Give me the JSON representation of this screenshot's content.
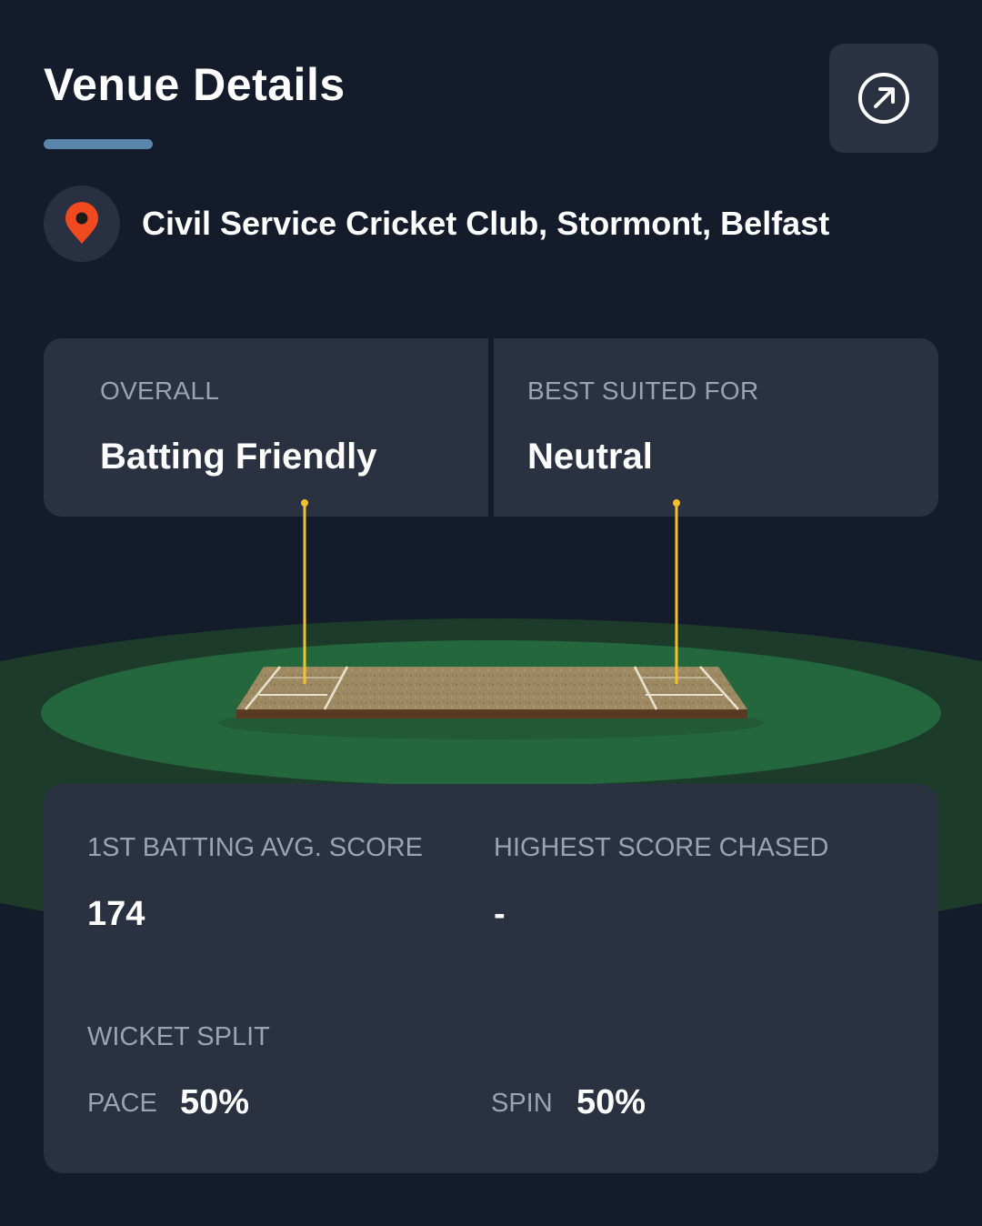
{
  "header": {
    "title": "Venue Details",
    "open_icon": "arrow-up-right-circle-icon"
  },
  "venue": {
    "icon": "location-pin-icon",
    "name": "Civil Service Cricket Club, Stormont, Belfast"
  },
  "pitch_summary": {
    "overall": {
      "label": "OVERALL",
      "value": "Batting Friendly"
    },
    "best_suited": {
      "label": "BEST SUITED FOR",
      "value": "Neutral"
    }
  },
  "stats": {
    "first_batting_avg": {
      "label": "1ST BATTING AVG. SCORE",
      "value": "174"
    },
    "highest_chased": {
      "label": "HIGHEST SCORE CHASED",
      "value": "-"
    },
    "wicket_split": {
      "label": "WICKET SPLIT",
      "pace": {
        "label": "PACE",
        "value": "50%"
      },
      "spin": {
        "label": "SPIN",
        "value": "50%"
      }
    }
  },
  "colors": {
    "background": "#141b2b",
    "card": "#2a3141",
    "accent_underline": "#5b86ab",
    "pin": "#f04a1e",
    "field_outer": "#1c3b2a",
    "field_inner": "#25673c",
    "pitch": "#9d8a62",
    "marker": "#f2c12e"
  }
}
